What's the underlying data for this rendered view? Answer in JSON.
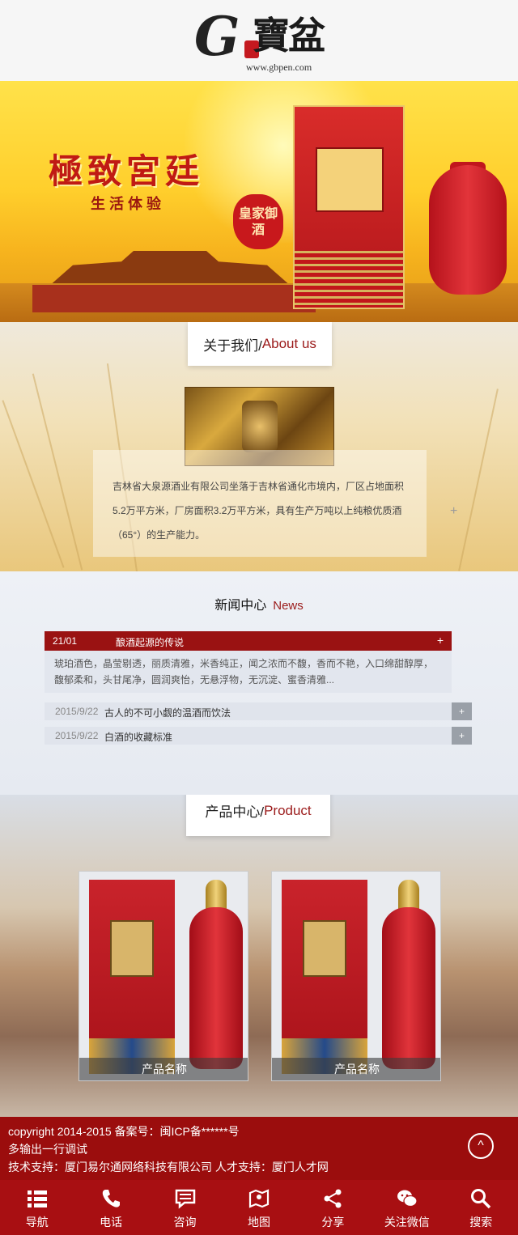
{
  "header": {
    "logo_g": "G",
    "logo_cn": "寶盆",
    "logo_url": "www.gbpen.com"
  },
  "banner": {
    "title": "極致宮廷",
    "subtitle": "生活体验",
    "seal": "皇家御酒"
  },
  "about": {
    "title_cn": "关于我们/",
    "title_en": "About us",
    "text": "吉林省大泉源酒业有限公司坐落于吉林省通化市境内，厂区占地面积5.2万平方米，厂房面积3.2万平方米，具有生产万吨以上纯粮优质酒（65°）的生产能力。",
    "plus": "+"
  },
  "news": {
    "title_cn": "新闻中心",
    "title_en": "News",
    "featured": {
      "date": "21/01",
      "title": "酿酒起源的传说",
      "plus": "+",
      "excerpt": "琥珀酒色，晶莹剔透，丽质清雅，米香纯正，闻之浓而不馥，香而不艳，入口绵甜醇厚，馥郁柔和，头甘尾净，圆润爽怡，无悬浮物，无沉淀、蜜香清雅..."
    },
    "items": [
      {
        "date": "2015/9/22",
        "title": "古人的不可小觑的温酒而饮法",
        "btn": "+"
      },
      {
        "date": "2015/9/22",
        "title": "白酒的收藏标准",
        "btn": "+"
      }
    ]
  },
  "products": {
    "title_cn": "产品中心/",
    "title_en": "Product",
    "items": [
      {
        "name": "产品名称"
      },
      {
        "name": "产品名称"
      }
    ]
  },
  "footer": {
    "line1": "copyright 2014-2015 备案号：闽ICP备******号",
    "line2": "多输出一行调试",
    "line3": "技术支持：厦门易尔通网络科技有限公司 人才支持：厦门人才网",
    "top_icon": "^"
  },
  "bottom_nav": [
    {
      "label": "导航",
      "icon": "list-icon"
    },
    {
      "label": "电话",
      "icon": "phone-icon"
    },
    {
      "label": "咨询",
      "icon": "chat-icon"
    },
    {
      "label": "地图",
      "icon": "map-icon"
    },
    {
      "label": "分享",
      "icon": "share-icon"
    },
    {
      "label": "关注微信",
      "icon": "wechat-icon"
    },
    {
      "label": "搜索",
      "icon": "search-icon"
    }
  ]
}
